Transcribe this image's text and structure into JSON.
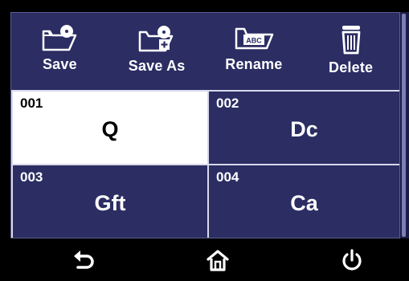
{
  "toolbar": {
    "save_label": "Save",
    "save_as_label": "Save As",
    "rename_label": "Rename",
    "rename_icon_text": "ABC",
    "delete_label": "Delete"
  },
  "slots": [
    {
      "number": "001",
      "name": "Q",
      "selected": true
    },
    {
      "number": "002",
      "name": "Dc",
      "selected": false
    },
    {
      "number": "003",
      "name": "Gft",
      "selected": false
    },
    {
      "number": "004",
      "name": "Ca",
      "selected": false
    }
  ],
  "colors": {
    "panel_bg": "#2b2d63",
    "selected_bg": "#ffffff",
    "text": "#ffffff",
    "background": "#000000"
  },
  "icons": {
    "save": "folder-disc-icon",
    "save_as": "folder-disc-plus-icon",
    "rename": "folder-abc-icon",
    "delete": "trash-can-icon",
    "back": "back-arrow-icon",
    "home": "home-icon",
    "power": "power-icon"
  }
}
